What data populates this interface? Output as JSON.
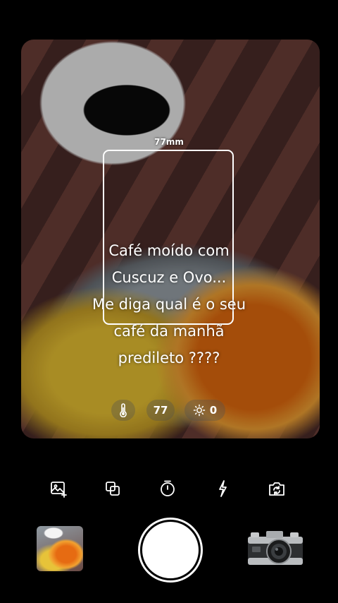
{
  "viewfinder": {
    "focal_label": "77mm",
    "caption": "Café moído com\nCuscuz e Ovo...\nMe diga qual é o seu\ncafé da manhã\npredileto ????",
    "temperature_icon": "thermometer-icon",
    "iso_value": "77",
    "exposure_icon": "brightness-icon",
    "exposure_value": "0"
  },
  "toolbar": {
    "items": [
      {
        "name": "add-image",
        "icon": "image-plus-icon"
      },
      {
        "name": "layers",
        "icon": "layers-icon"
      },
      {
        "name": "timer",
        "icon": "timer-icon"
      },
      {
        "name": "flash",
        "icon": "flash-icon"
      },
      {
        "name": "flip-camera",
        "icon": "camera-rotate-icon"
      }
    ]
  },
  "bottom": {
    "gallery_icon": "gallery-thumbnail",
    "shutter_icon": "shutter-button",
    "camera_model_icon": "vintage-camera-icon"
  },
  "colors": {
    "background": "#000000",
    "foreground": "#ffffff"
  }
}
